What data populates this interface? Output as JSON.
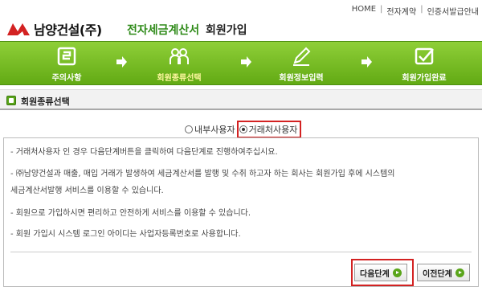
{
  "topnav": {
    "home": "HOME",
    "contract": "전자계약",
    "cert": "인증서발급안내"
  },
  "logo": {
    "name": "남양건설(주)"
  },
  "header": {
    "service": "전자세금계산서",
    "page_title": "회원가입"
  },
  "steps": [
    {
      "label": "주의사항",
      "icon": "notice-icon"
    },
    {
      "label": "회원종류선택",
      "icon": "members-icon",
      "active": true
    },
    {
      "label": "회원정보입력",
      "icon": "pencil-icon"
    },
    {
      "label": "회원가입완료",
      "icon": "checkbox-icon"
    }
  ],
  "section": {
    "title": "회원종류선택"
  },
  "radios": {
    "internal": "내부사용자",
    "partner": "거래처사용자",
    "selected": "partner"
  },
  "info": {
    "line1": "- 거래처사용자 인 경우 다음단계버튼을 클릭하여 다음단계로 진행하여주십시요.",
    "line2": "- ㈜남양건설과 매출, 매입 거래가 발생하여 세금계산서를 발행 및 수취 하고자 하는 회사는 회원가입 후에 시스템의",
    "line3": "세금계산서발행 서비스를 이용할 수 있습니다.",
    "line4": "- 회원으로 가입하시면 편리하고 안전하게 서비스를 이용할 수 있습니다.",
    "line5": "- 회원 가입시 시스템 로그인 아이디는 사업자등록번호로 사용합니다."
  },
  "buttons": {
    "next": "다음단계",
    "prev": "이전단계"
  },
  "colors": {
    "brand_green": "#2e8a18",
    "bar_green": "#62aa14",
    "highlight_red": "#d32222"
  }
}
